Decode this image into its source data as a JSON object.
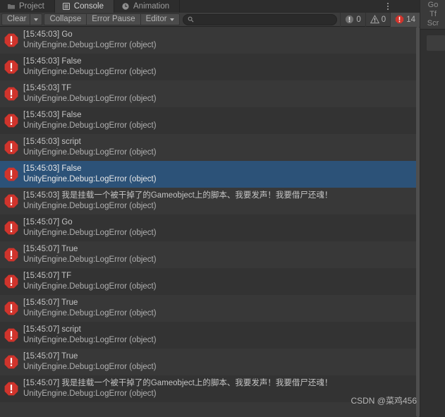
{
  "window": {
    "tabs": [
      {
        "label": "Project",
        "icon": "folder-icon",
        "active": false
      },
      {
        "label": "Console",
        "icon": "list-icon",
        "active": true
      },
      {
        "label": "Animation",
        "icon": "clock-icon",
        "active": false
      }
    ],
    "overflow_menu_icon": "kebab-menu-icon"
  },
  "toolbar": {
    "clear_label": "Clear",
    "clear_dropdown_icon": "chevron-down-icon",
    "collapse_label": "Collapse",
    "error_pause_label": "Error Pause",
    "editor_label": "Editor",
    "editor_dropdown_icon": "chevron-down-icon",
    "search": {
      "icon": "search-icon",
      "value": "",
      "placeholder": ""
    },
    "counters": [
      {
        "name": "info",
        "icon": "info-icon",
        "count": "0",
        "active": false
      },
      {
        "name": "warning",
        "icon": "warning-icon",
        "count": "0",
        "active": false
      },
      {
        "name": "error",
        "icon": "error-icon",
        "count": "14",
        "active": true
      }
    ]
  },
  "console": {
    "entry_icon": "error-icon",
    "entries": [
      {
        "message": "[15:45:03] Go",
        "stack": "UnityEngine.Debug:LogError (object)",
        "selected": false
      },
      {
        "message": "[15:45:03] False",
        "stack": "UnityEngine.Debug:LogError (object)",
        "selected": false
      },
      {
        "message": "[15:45:03] TF",
        "stack": "UnityEngine.Debug:LogError (object)",
        "selected": false
      },
      {
        "message": "[15:45:03] False",
        "stack": "UnityEngine.Debug:LogError (object)",
        "selected": false
      },
      {
        "message": "[15:45:03] script",
        "stack": "UnityEngine.Debug:LogError (object)",
        "selected": false
      },
      {
        "message": "[15:45:03] False",
        "stack": "UnityEngine.Debug:LogError (object)",
        "selected": true
      },
      {
        "message": "[15:45:03] 我是挂载一个被干掉了的Gameobject上的脚本、我要发声！我要借尸还魂！",
        "stack": "UnityEngine.Debug:LogError (object)",
        "selected": false
      },
      {
        "message": "[15:45:07] Go",
        "stack": "UnityEngine.Debug:LogError (object)",
        "selected": false
      },
      {
        "message": "[15:45:07] True",
        "stack": "UnityEngine.Debug:LogError (object)",
        "selected": false
      },
      {
        "message": "[15:45:07] TF",
        "stack": "UnityEngine.Debug:LogError (object)",
        "selected": false
      },
      {
        "message": "[15:45:07] True",
        "stack": "UnityEngine.Debug:LogError (object)",
        "selected": false
      },
      {
        "message": "[15:45:07] script",
        "stack": "UnityEngine.Debug:LogError (object)",
        "selected": false
      },
      {
        "message": "[15:45:07] True",
        "stack": "UnityEngine.Debug:LogError (object)",
        "selected": false
      },
      {
        "message": "[15:45:07] 我是挂载一个被干掉了的Gameobject上的脚本、我要发声！我要借尸还魂！",
        "stack": "UnityEngine.Debug:LogError (object)",
        "selected": false
      }
    ]
  },
  "right_panel": {
    "lines": [
      "Go",
      "Tf",
      "Scr"
    ]
  },
  "watermark": {
    "text": "CSDN @菜鸡456"
  },
  "colors": {
    "background": "#383838",
    "row_alt": "#333333",
    "selection": "#2c5278",
    "toolbar": "#3c3c3c",
    "tabbar": "#2d2d2d",
    "error_red": "#d0342c",
    "text": "#c4c4c4"
  }
}
